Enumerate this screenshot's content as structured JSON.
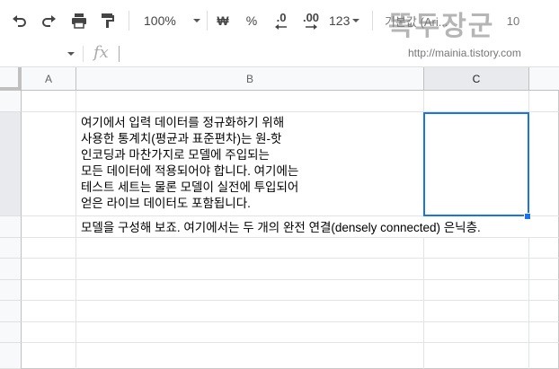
{
  "toolbar": {
    "zoom": "100%",
    "currency_symbol": "₩",
    "percent_symbol": "%",
    "decrease_decimal": ".0",
    "increase_decimal": ".00",
    "number_format": "123",
    "font_name": "기본값 (Ari...",
    "font_size": "10"
  },
  "formula_bar": {
    "name_box_value": "",
    "fx_label": "fx",
    "formula_value": ""
  },
  "watermark": {
    "text": "똑두장군",
    "url": "http://mainia.tistory.com"
  },
  "columns": [
    "A",
    "B",
    "C"
  ],
  "cells": {
    "B_multiline": "여기에서 입력 데이터를 정규화하기 위해\n사용한 통계치(평균과 표준편차)는 원-핫\n인코딩과 마찬가지로 모델에 주입되는\n모든 데이터에 적용되어야 합니다. 여기에는\n테스트 세트는 물론 모델이 실전에 투입되어\n얻은 라이브 데이터도 포함됩니다.",
    "B_next": "모델을 구성해 보죠. 여기에서는 두 개의 완전 연결(densely connected) 은닉층."
  },
  "colors": {
    "accent": "#1a73e8",
    "header_bg": "#f8f9fa",
    "selected_header_bg": "#e8eaed"
  }
}
